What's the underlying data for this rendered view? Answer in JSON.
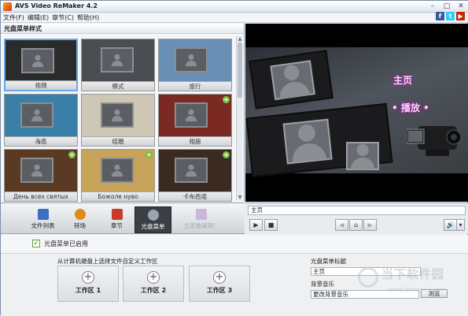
{
  "app": {
    "title": "AVS Video ReMaker 4.2"
  },
  "window_controls": [
    "–",
    "□",
    "✕"
  ],
  "menu": [
    "文件(F)",
    "编辑(E)",
    "章节(C)",
    "帮助(H)"
  ],
  "social": [
    {
      "label": "f",
      "color": "#3b5998"
    },
    {
      "label": "t",
      "color": "#33ccff"
    },
    {
      "label": "▶",
      "color": "#cc2200"
    }
  ],
  "left_panel": {
    "header": "光盘菜单样式",
    "thumbnails": [
      {
        "caption": "视频",
        "bg": "#2b2b2b",
        "selected": true,
        "badge": false
      },
      {
        "caption": "模式",
        "bg": "#4a4d52",
        "selected": false,
        "badge": false
      },
      {
        "caption": "旅行",
        "bg": "#6a8fb5",
        "selected": false,
        "badge": false
      },
      {
        "caption": "海底",
        "bg": "#3a7fa8",
        "selected": false,
        "badge": false
      },
      {
        "caption": "结婚",
        "bg": "#cfc7b5",
        "selected": false,
        "badge": false
      },
      {
        "caption": "相册",
        "bg": "#7a2a22",
        "selected": false,
        "badge": true
      },
      {
        "caption": "День всех святых",
        "bg": "#5a3a22",
        "selected": false,
        "badge": true
      },
      {
        "caption": "Божоле нуво",
        "bg": "#c8a45a",
        "selected": false,
        "badge": true
      },
      {
        "caption": "卡布西诺",
        "bg": "#3a2a20",
        "selected": false,
        "badge": true
      }
    ]
  },
  "preview": {
    "title": "主页",
    "play": "• 播放 •"
  },
  "tabs": [
    {
      "label": "文件列表",
      "icon_color": "#3a6fc4",
      "state": "normal"
    },
    {
      "label": "转场",
      "icon_color": "#e08a1a",
      "state": "normal"
    },
    {
      "label": "章节",
      "icon_color": "#c83a2a",
      "state": "normal"
    },
    {
      "label": "光盘菜单",
      "icon_color": "#9aa4b0",
      "state": "active"
    },
    {
      "label": "立即重编辑！",
      "icon_color": "#c8b8d8",
      "state": "disabled"
    }
  ],
  "player": {
    "chapter": "主页",
    "buttons": [
      "▶",
      "■",
      "◀",
      "⌂",
      "▶",
      "🔊",
      "▾"
    ]
  },
  "enabled": {
    "label": "光盘菜单已启用",
    "checked": true
  },
  "bottom": {
    "instruction": "从计算机硬盘上选择文件自定义工作区",
    "workareas": [
      "工作区 1",
      "工作区 2",
      "工作区 3"
    ],
    "menu_title_label": "光盘菜单标题",
    "menu_title_value": "主页",
    "bg_music_label": "背景音乐",
    "bg_music_value": "更改背景音乐",
    "browse": "浏览"
  },
  "watermark": {
    "line1": "当下软件园",
    "line2": "www.downxia.com"
  }
}
